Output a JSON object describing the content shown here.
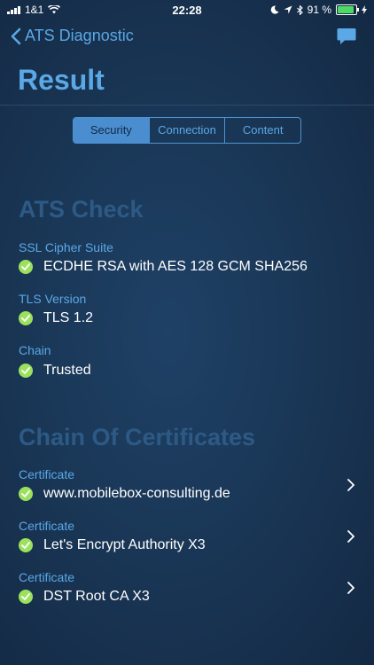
{
  "status_bar": {
    "carrier": "1&1",
    "time": "22:28",
    "battery": "91 %",
    "battery_level": 0.91
  },
  "nav": {
    "back_label": "ATS Diagnostic"
  },
  "page": {
    "title": "Result"
  },
  "tabs": [
    {
      "label": "Security",
      "active": true
    },
    {
      "label": "Connection",
      "active": false
    },
    {
      "label": "Content",
      "active": false
    }
  ],
  "ats_check": {
    "heading": "ATS Check",
    "items": [
      {
        "label": "SSL Cipher Suite",
        "value": "ECDHE RSA with AES 128 GCM SHA256"
      },
      {
        "label": "TLS Version",
        "value": "TLS 1.2"
      },
      {
        "label": "Chain",
        "value": "Trusted"
      }
    ]
  },
  "chain": {
    "heading": "Chain Of Certificates",
    "items": [
      {
        "label": "Certificate",
        "value": "www.mobilebox-consulting.de"
      },
      {
        "label": "Certificate",
        "value": "Let's Encrypt Authority X3"
      },
      {
        "label": "Certificate",
        "value": "DST Root CA X3"
      }
    ]
  },
  "colors": {
    "accent": "#5aa8e6",
    "check": "#9be15d",
    "background": "#1a3757"
  }
}
